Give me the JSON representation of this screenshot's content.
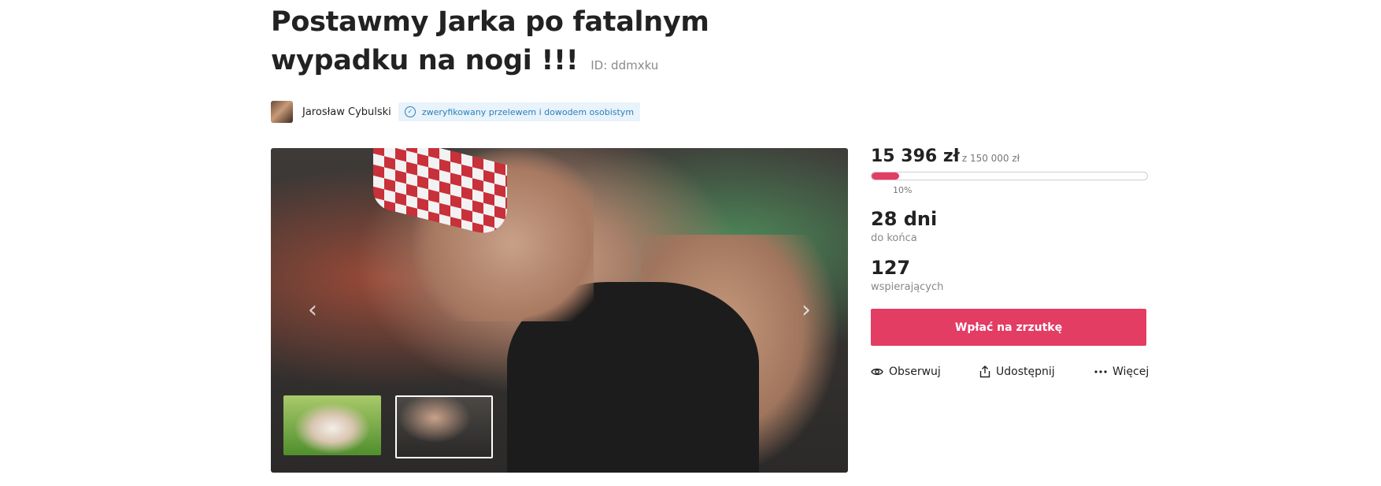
{
  "campaign": {
    "title": "Postawmy Jarka po fatalnym wypadku na nogi !!!",
    "id_label": "ID: ddmxku"
  },
  "author": {
    "name": "Jarosław Cybulski",
    "verified_label": "zweryfikowany przelewem i dowodem osobistym"
  },
  "funding": {
    "raised": "15 396 zł",
    "goal": "z 150 000 zł",
    "percent_label": "10%",
    "progress_fraction": 0.1,
    "days_value": "28 dni",
    "days_label": "do końca",
    "supporters_value": "127",
    "supporters_label": "wspierających"
  },
  "cta": {
    "donate_label": "Wpłać na zrzutkę"
  },
  "actions": {
    "follow": "Obserwuj",
    "share": "Udostępnij",
    "more": "Więcej"
  },
  "icons": {
    "prev": "chevron-left-icon",
    "next": "chevron-right-icon",
    "follow": "eye-icon",
    "share": "share-icon",
    "more": "ellipsis-icon",
    "verified": "check-circle-icon"
  },
  "colors": {
    "accent": "#e33d64",
    "verified_bg": "#e8f3fb",
    "verified_text": "#2c7fb8"
  }
}
